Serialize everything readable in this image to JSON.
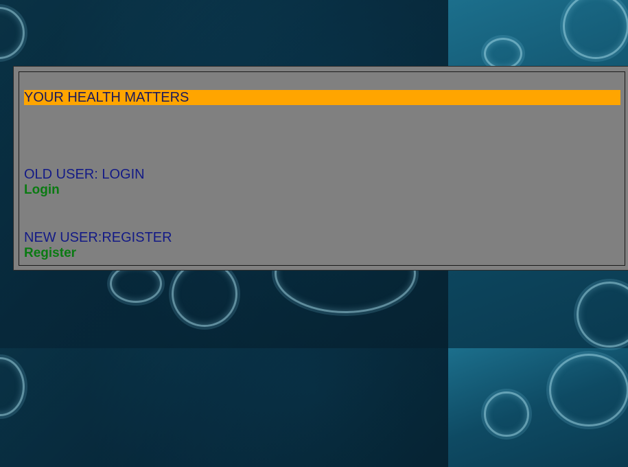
{
  "banner": {
    "text": "YOUR HEALTH MATTERS"
  },
  "old_user": {
    "label": "OLD USER: LOGIN",
    "link": "Login"
  },
  "new_user": {
    "label": "NEW USER:REGISTER",
    "link": "Register"
  },
  "colors": {
    "banner_bg": "#ffa500",
    "panel_bg": "#808080",
    "label_text": "#131a86",
    "link_text": "#0a7a12",
    "background": "#0b3346"
  },
  "background_image": {
    "icon": "coronavirus-icon"
  }
}
